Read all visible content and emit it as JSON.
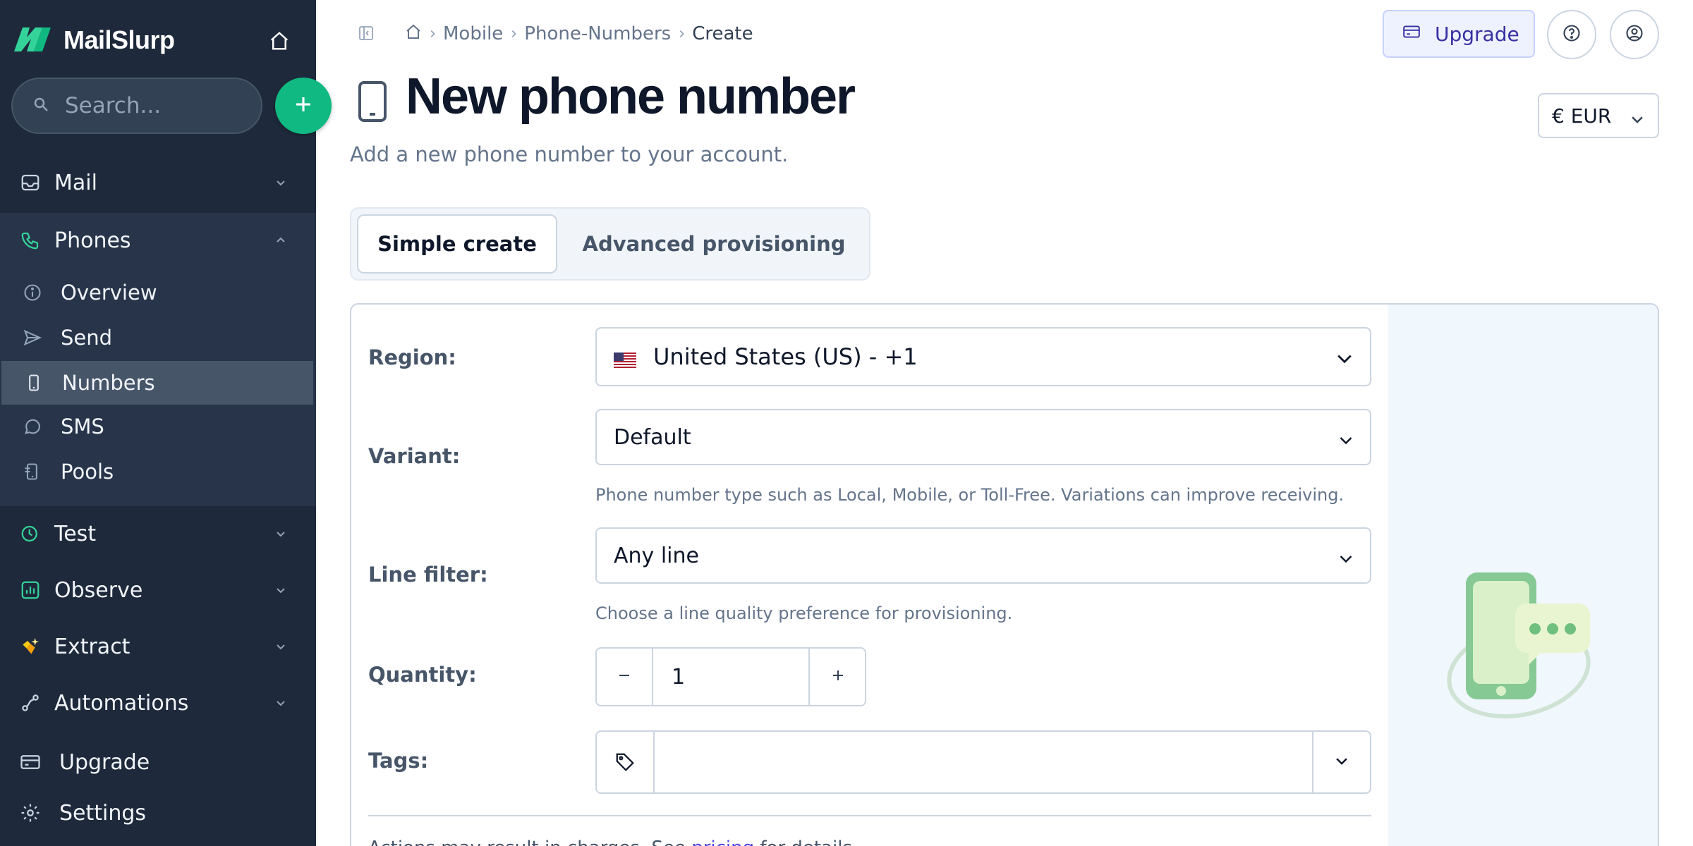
{
  "app": {
    "name": "MailSlurp"
  },
  "sidebar": {
    "search_placeholder": "Search...",
    "items": {
      "mail": "Mail",
      "phones": "Phones",
      "test": "Test",
      "observe": "Observe",
      "extract": "Extract",
      "automations": "Automations",
      "upgrade": "Upgrade",
      "settings": "Settings"
    },
    "phones_sub": {
      "overview": "Overview",
      "send": "Send",
      "numbers": "Numbers",
      "sms": "SMS",
      "pools": "Pools"
    },
    "active_item": "Numbers"
  },
  "breadcrumb": {
    "items": [
      "Mobile",
      "Phone-Numbers",
      "Create"
    ]
  },
  "topbar": {
    "upgrade_label": "Upgrade"
  },
  "header": {
    "title": "New phone number",
    "subtitle": "Add a new phone number to your account.",
    "currency": "€ EUR"
  },
  "tabs": {
    "simple": "Simple create",
    "advanced": "Advanced provisioning",
    "active": "Simple create"
  },
  "form": {
    "region": {
      "label": "Region:",
      "value": "United States (US) - +1"
    },
    "variant": {
      "label": "Variant:",
      "value": "Default",
      "help": "Phone number type such as Local, Mobile, or Toll-Free. Variations can improve receiving."
    },
    "line_filter": {
      "label": "Line filter:",
      "value": "Any line",
      "help": "Choose a line quality preference for provisioning."
    },
    "quantity": {
      "label": "Quantity:",
      "value": "1"
    },
    "tags": {
      "label": "Tags:",
      "value": ""
    },
    "footnote": {
      "before": "Actions may result in charges. See ",
      "link": "pricing",
      "after": " for details."
    }
  },
  "colors": {
    "sidebar_bg": "#1e293b",
    "accent_green": "#10b981",
    "upgrade_bg": "#eef2ff",
    "upgrade_text": "#3730a3"
  }
}
